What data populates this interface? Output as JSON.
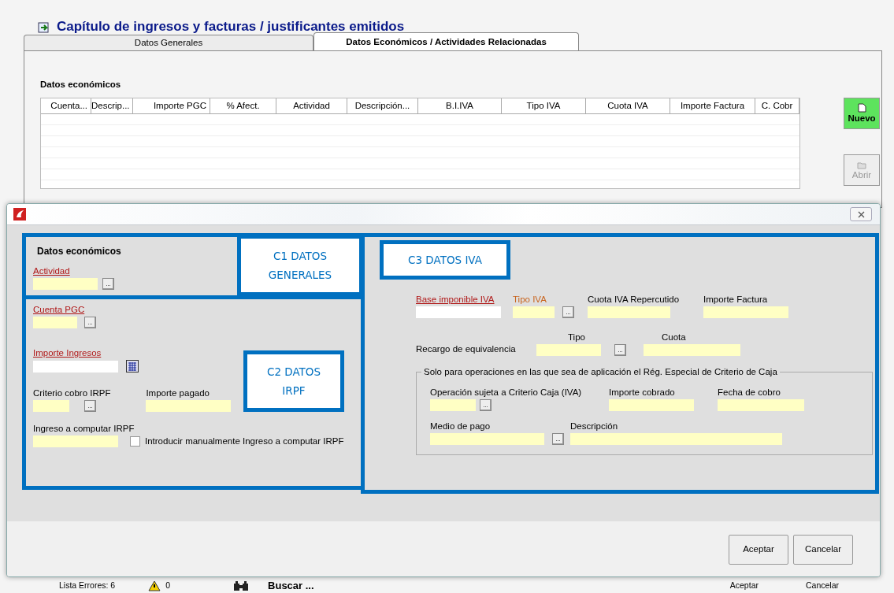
{
  "window": {
    "title": "Capítulo de ingresos y facturas / justificantes emitidos"
  },
  "tabs": [
    {
      "label": "Datos Generales",
      "selected": false
    },
    {
      "label": "Datos Económicos / Actividades Relacionadas",
      "selected": true
    }
  ],
  "section_title": "Datos económicos",
  "table": {
    "columns": [
      "Cuenta...",
      "Descrip...",
      "Importe PGC",
      "% Afect.",
      "Actividad",
      "Descripción...",
      "B.I.IVA",
      "Tipo IVA",
      "Cuota IVA",
      "Importe Factura",
      "C. Cobr"
    ]
  },
  "side_buttons": [
    {
      "label": "Nuevo",
      "disabled": false
    },
    {
      "label": "Abrir",
      "disabled": true
    }
  ],
  "dialog": {
    "general": {
      "heading": "Datos económicos",
      "fields": [
        {
          "label": "Actividad",
          "kind": "link",
          "highlighted": true,
          "addon": {
            "kind": "lookup",
            "label": "..."
          }
        }
      ]
    },
    "irpf": {
      "fields": [
        {
          "label": "Cuenta PGC",
          "kind": "link",
          "highlighted": true,
          "addon": {
            "kind": "lookup",
            "label": "..."
          }
        },
        {
          "label": "Importe Ingresos",
          "kind": "link",
          "highlighted": false,
          "addon": {
            "kind": "calculator"
          }
        },
        {
          "label": "Criterio cobro IRPF",
          "kind": "plain",
          "highlighted": true,
          "addon": {
            "kind": "lookup",
            "label": "..."
          }
        },
        {
          "label": "Importe pagado",
          "kind": "plain",
          "highlighted": true
        },
        {
          "label": "Ingreso a computar IRPF",
          "kind": "plain",
          "highlighted": true
        }
      ],
      "checkbox": {
        "label": "Introducir manualmente Ingreso a computar IRPF",
        "checked": false
      }
    },
    "iva": {
      "fields": [
        {
          "label": "Base imponible IVA",
          "kind": "link",
          "highlighted": false
        },
        {
          "label": "Tipo IVA",
          "kind": "accent",
          "highlighted": true,
          "addon": {
            "kind": "lookup",
            "label": "..."
          }
        },
        {
          "label": "Cuota IVA Repercutido",
          "kind": "plain",
          "highlighted": true
        },
        {
          "label": "Importe Factura",
          "kind": "plain",
          "highlighted": true
        }
      ],
      "surcharge": {
        "label": "Recargo de equivalencia",
        "fields": [
          {
            "label": "Tipo",
            "kind": "plain",
            "highlighted": true,
            "addon": {
              "kind": "lookup",
              "label": "..."
            }
          },
          {
            "label": "Cuota",
            "kind": "plain",
            "highlighted": true
          }
        ]
      },
      "cash_criterion": {
        "legend": "Solo para operaciones en las que sea de aplicación el Rég. Especial de Criterio de Caja",
        "fields": [
          {
            "label": "Operación sujeta a Criterio Caja (IVA)",
            "kind": "plain",
            "highlighted": true,
            "addon": {
              "kind": "lookup",
              "label": "..."
            }
          },
          {
            "label": "Importe cobrado",
            "kind": "plain",
            "highlighted": true
          },
          {
            "label": "Fecha de cobro",
            "kind": "plain",
            "highlighted": true
          },
          {
            "label": "Medio de pago",
            "kind": "plain",
            "highlighted": true,
            "addon": {
              "kind": "lookup",
              "label": "..."
            }
          },
          {
            "label": "Descripción",
            "kind": "plain",
            "highlighted": true
          }
        ]
      }
    },
    "annotations": [
      {
        "label": "C1 DATOS GENERALES"
      },
      {
        "label": "C2 DATOS IRPF"
      },
      {
        "label": "C3 DATOS IVA"
      }
    ],
    "buttons": [
      "Aceptar",
      "Cancelar"
    ]
  },
  "status_bar": {
    "errors": "Lista Errores: 6",
    "warnings": "0",
    "search": "Buscar ...",
    "buttons": [
      "Aceptar",
      "Cancelar"
    ]
  }
}
